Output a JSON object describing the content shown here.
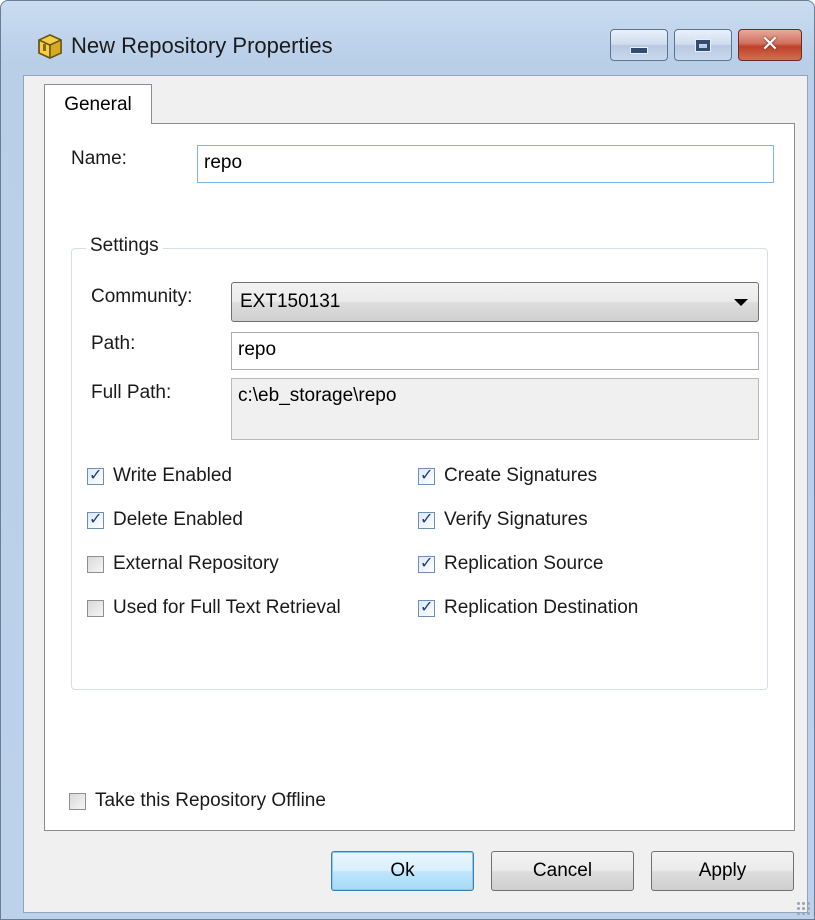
{
  "window": {
    "title": "New Repository Properties",
    "close_glyph": "✕",
    "accent": "#3c7fb1"
  },
  "tabs": [
    {
      "label": "General",
      "selected": true
    }
  ],
  "general": {
    "name_label": "Name:",
    "name_value": "repo",
    "settings": {
      "title": "Settings",
      "community_label": "Community:",
      "community_value": "EXT150131",
      "path_label": "Path:",
      "path_value": "repo",
      "full_path_label": "Full Path:",
      "full_path_value": "c:\\eb_storage\\repo"
    },
    "checkboxes": [
      {
        "label": "Write Enabled",
        "checked": true
      },
      {
        "label": "Delete Enabled",
        "checked": true
      },
      {
        "label": "External Repository",
        "checked": false
      },
      {
        "label": "Used for Full Text Retrieval",
        "checked": false
      },
      {
        "label": "Create Signatures",
        "checked": true
      },
      {
        "label": "Verify Signatures",
        "checked": true
      },
      {
        "label": "Replication Source",
        "checked": true
      },
      {
        "label": "Replication Destination",
        "checked": true
      }
    ],
    "offline": {
      "label": "Take this Repository Offline",
      "checked": false
    }
  },
  "buttons": {
    "ok": "Ok",
    "cancel": "Cancel",
    "apply": "Apply"
  },
  "check_glyph": "✓"
}
